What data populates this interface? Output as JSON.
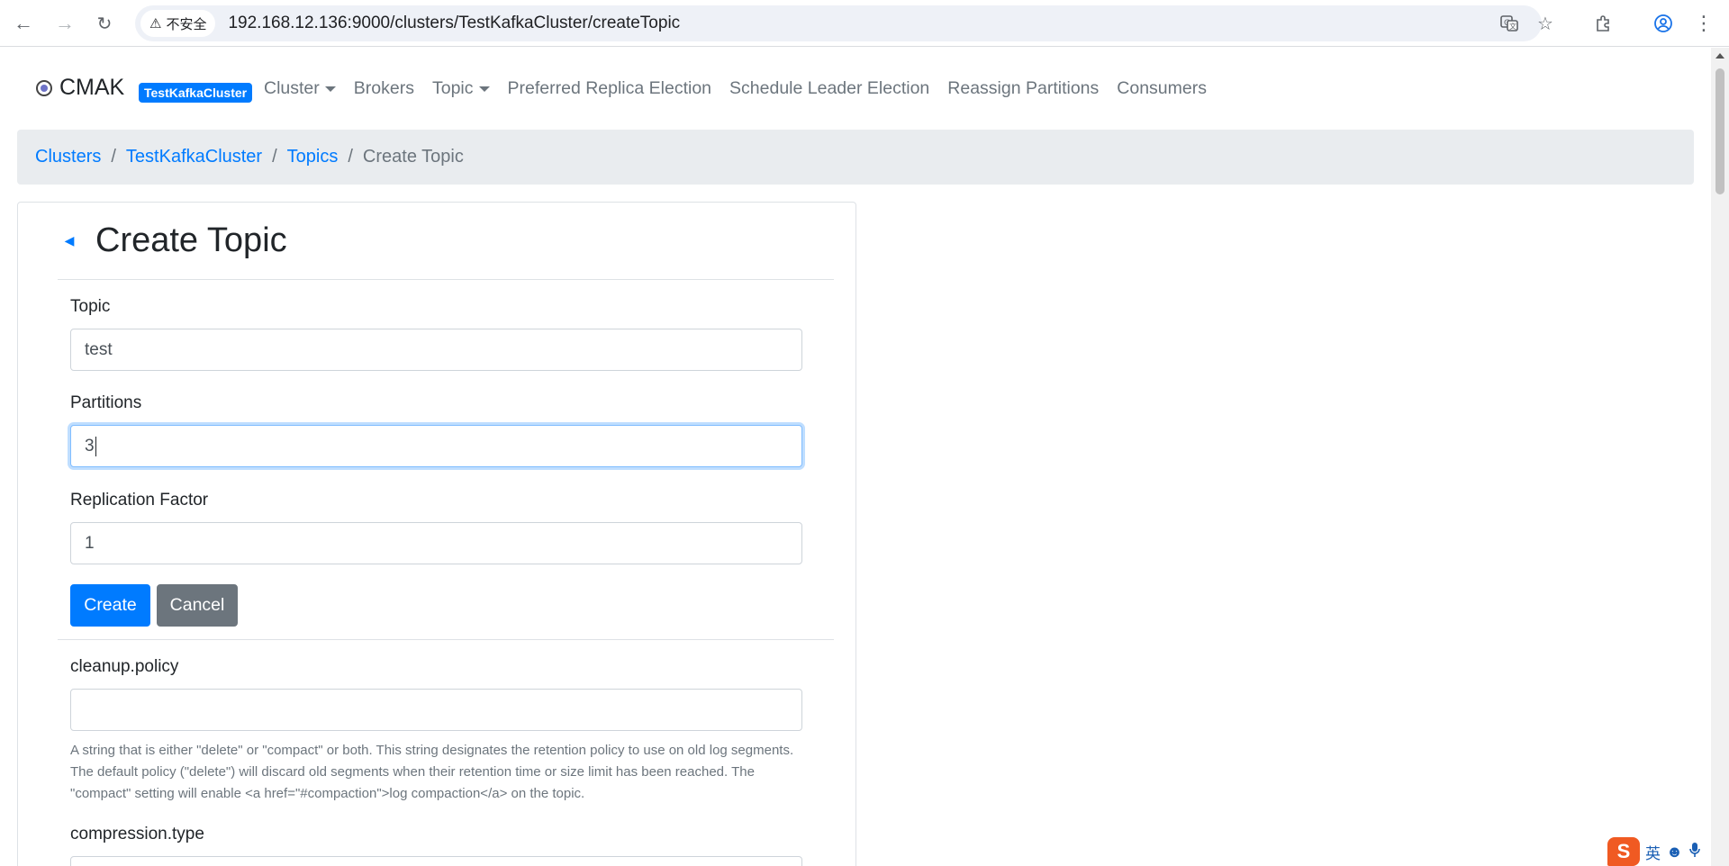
{
  "browser": {
    "security_label": "不安全",
    "url": "192.168.12.136:9000/clusters/TestKafkaCluster/createTopic"
  },
  "navbar": {
    "brand": "CMAK",
    "cluster_badge": "TestKafkaCluster",
    "items": [
      {
        "label": "Cluster",
        "dropdown": true
      },
      {
        "label": "Brokers",
        "dropdown": false
      },
      {
        "label": "Topic",
        "dropdown": true
      },
      {
        "label": "Preferred Replica Election",
        "dropdown": false
      },
      {
        "label": "Schedule Leader Election",
        "dropdown": false
      },
      {
        "label": "Reassign Partitions",
        "dropdown": false
      },
      {
        "label": "Consumers",
        "dropdown": false
      }
    ]
  },
  "breadcrumb": {
    "items": [
      "Clusters",
      "TestKafkaCluster",
      "Topics"
    ],
    "active": "Create Topic",
    "separator": "/"
  },
  "card": {
    "title": "Create Topic"
  },
  "form": {
    "topic": {
      "label": "Topic",
      "value": "test"
    },
    "partitions": {
      "label": "Partitions",
      "value": "3"
    },
    "replication": {
      "label": "Replication Factor",
      "value": "1"
    },
    "create_label": "Create",
    "cancel_label": "Cancel"
  },
  "configs": [
    {
      "name": "cleanup.policy",
      "value": "",
      "help": "A string that is either \"delete\" or \"compact\" or both. This string designates the retention policy to use on old log segments. The default policy (\"delete\") will discard old segments when their retention time or size limit has been reached. The \"compact\" setting will enable <a href=\"#compaction\">log compaction</a> on the topic."
    },
    {
      "name": "compression.type",
      "value": "",
      "help": ""
    }
  ],
  "ime": {
    "logo": "S",
    "mode": "英"
  },
  "colors": {
    "primary": "#007bff",
    "secondary": "#6c757d",
    "breadcrumb_bg": "#e9ecef"
  }
}
